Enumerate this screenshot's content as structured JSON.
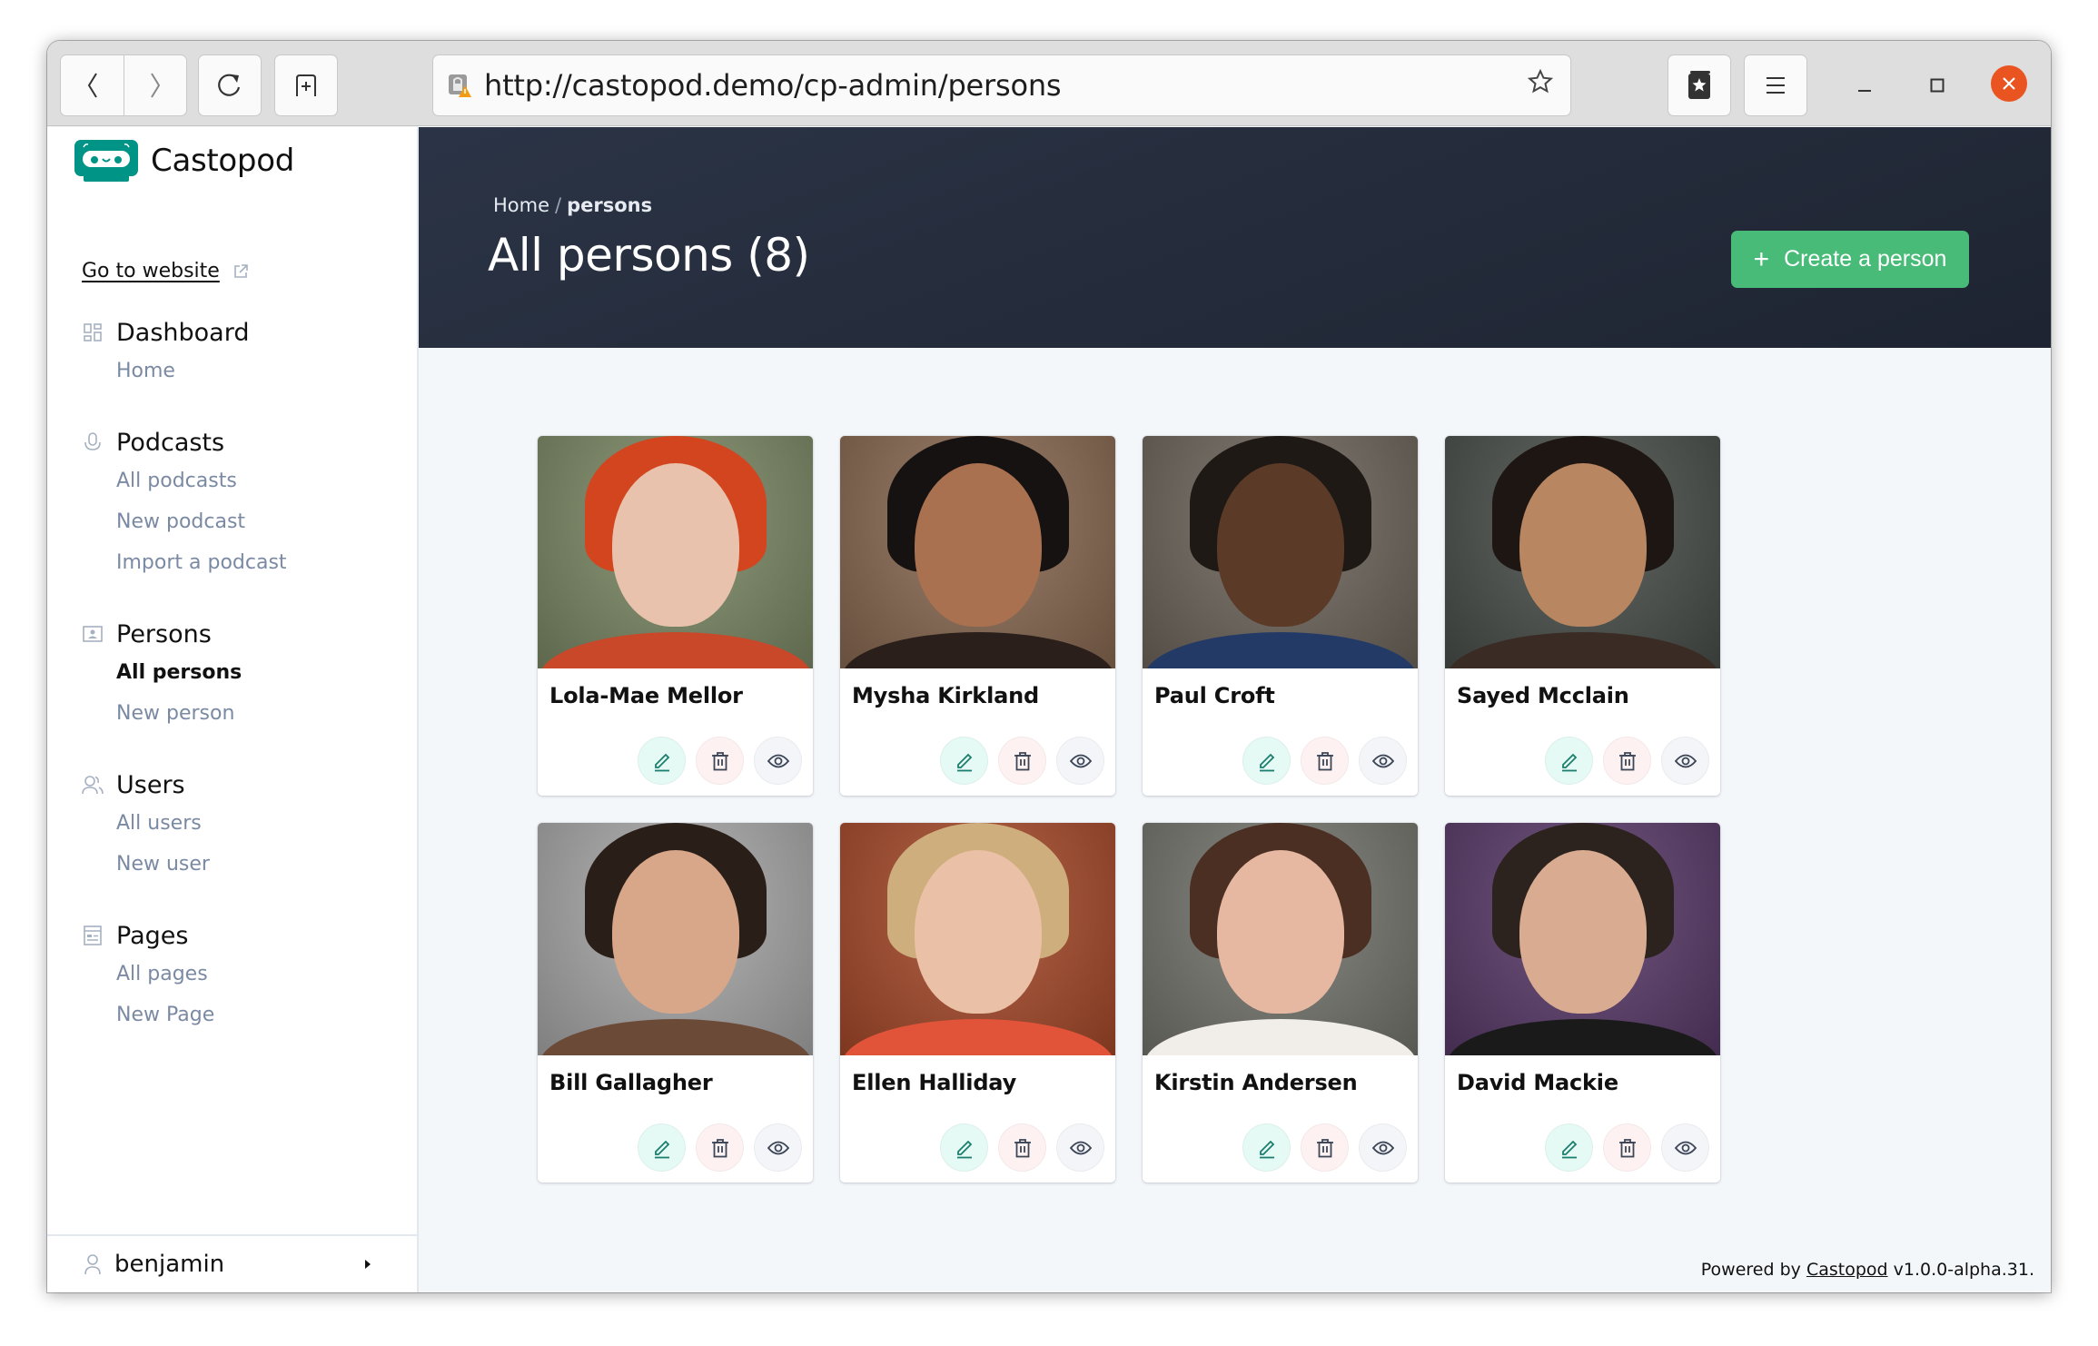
{
  "browser": {
    "url": "http://castopod.demo/cp-admin/persons",
    "icons": {
      "back": "chevron-left-icon",
      "forward": "chevron-right-icon",
      "reload": "reload-icon",
      "new_tab": "new-tab-icon",
      "insecure": "insecure-lock-warning-icon",
      "bookmark": "star-icon",
      "library": "bookmarks-library-icon",
      "menu": "hamburger-menu-icon",
      "minimize": "minimize-icon",
      "maximize": "maximize-icon",
      "close": "close-icon"
    },
    "close_color": "#e95420"
  },
  "sidebar": {
    "brand": "Castopod",
    "brand_color": "#009486",
    "go_to_website": "Go to website",
    "groups": [
      {
        "label": "Dashboard",
        "icon": "dashboard-grid-icon",
        "items": [
          {
            "label": "Home",
            "active": false
          }
        ]
      },
      {
        "label": "Podcasts",
        "icon": "microphone-icon",
        "items": [
          {
            "label": "All podcasts",
            "active": false
          },
          {
            "label": "New podcast",
            "active": false
          },
          {
            "label": "Import a podcast",
            "active": false
          }
        ]
      },
      {
        "label": "Persons",
        "icon": "person-folder-icon",
        "items": [
          {
            "label": "All persons",
            "active": true
          },
          {
            "label": "New person",
            "active": false
          }
        ]
      },
      {
        "label": "Users",
        "icon": "users-icon",
        "items": [
          {
            "label": "All users",
            "active": false
          },
          {
            "label": "New user",
            "active": false
          }
        ]
      },
      {
        "label": "Pages",
        "icon": "pages-icon",
        "items": [
          {
            "label": "All pages",
            "active": false
          },
          {
            "label": "New Page",
            "active": false
          }
        ]
      }
    ],
    "user": {
      "name": "benjamin",
      "icon": "user-icon"
    }
  },
  "header": {
    "breadcrumb": {
      "home": "Home",
      "separator": "/",
      "current": "persons"
    },
    "title": "All persons (8)",
    "create_button": {
      "label": "Create a person",
      "icon": "plus-icon",
      "color": "#48bb78"
    }
  },
  "persons": [
    {
      "name": "Lola-Mae Mellor",
      "bg": "#7d8a66",
      "skin": "#e8c2ac",
      "hair": "#d2451f",
      "cloth": "#c9482a"
    },
    {
      "name": "Mysha Kirkland",
      "bg": "#8a6a52",
      "skin": "#a9714f",
      "hair": "#161212",
      "cloth": "#2a1f1a"
    },
    {
      "name": "Paul Croft",
      "bg": "#6e665c",
      "skin": "#5b3a28",
      "hair": "#1f1915",
      "cloth": "#243a66"
    },
    {
      "name": "Sayed Mcclain",
      "bg": "#4a4f4a",
      "skin": "#b98662",
      "hair": "#1d1612",
      "cloth": "#3a2c24"
    },
    {
      "name": "Bill Gallagher",
      "bg": "#aaaaaa",
      "skin": "#d8a78a",
      "hair": "#2a1e18",
      "cloth": "#6b4a38"
    },
    {
      "name": "Ellen Halliday",
      "bg": "#a84a2a",
      "skin": "#eac0a6",
      "hair": "#cfae7e",
      "cloth": "#e2543a"
    },
    {
      "name": "Kirstin Andersen",
      "bg": "#76766f",
      "skin": "#e6b8a2",
      "hair": "#4a2f22",
      "cloth": "#f1ede8"
    },
    {
      "name": "David Mackie",
      "bg": "#5a3a6a",
      "skin": "#d9ac92",
      "hair": "#2c231e",
      "cloth": "#1a1a1a"
    }
  ],
  "card_actions": {
    "edit": {
      "icon": "pencil-icon",
      "label": "Edit"
    },
    "delete": {
      "icon": "trash-icon",
      "label": "Delete"
    },
    "view": {
      "icon": "eye-icon",
      "label": "View"
    }
  },
  "footer": {
    "prefix": "Powered by",
    "link": "Castopod",
    "suffix": "v1.0.0-alpha.31."
  }
}
